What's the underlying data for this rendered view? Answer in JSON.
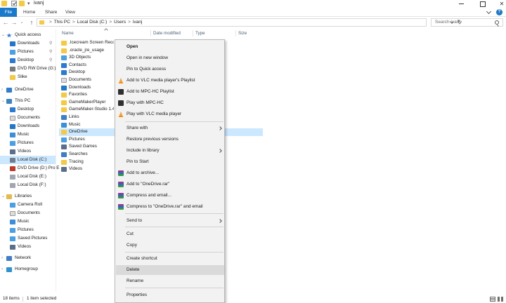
{
  "window": {
    "title": "ivanj"
  },
  "ribbon": {
    "tabs": [
      "File",
      "Home",
      "Share",
      "View"
    ]
  },
  "address": {
    "crumbs": [
      "This PC",
      "Local Disk (C:)",
      "Users",
      "ivanj"
    ],
    "separator": ">"
  },
  "search": {
    "placeholder": "Search ivanj"
  },
  "sidebar": {
    "quick_access": {
      "label": "Quick access",
      "items": [
        {
          "label": "Downloads",
          "pinned": true
        },
        {
          "label": "Pictures",
          "pinned": true
        },
        {
          "label": "Desktop",
          "pinned": true
        },
        {
          "label": "DVD RW Drive (G:)",
          "pinned": false
        },
        {
          "label": "Slike",
          "pinned": false
        }
      ]
    },
    "onedrive": {
      "label": "OneDrive"
    },
    "this_pc": {
      "label": "This PC",
      "items": [
        "Desktop",
        "Documents",
        "Downloads",
        "Music",
        "Pictures",
        "Videos",
        "Local Disk (C:)",
        "DVD Drive (D:) Pro E",
        "Local Disk (E:)",
        "Local Disk (F:)"
      ],
      "selected": "Local Disk (C:)"
    },
    "libraries": {
      "label": "Libraries",
      "items": [
        "Camera Roll",
        "Documents",
        "Music",
        "Pictures",
        "Saved Pictures",
        "Videos"
      ]
    },
    "network": {
      "label": "Network"
    },
    "homegroup": {
      "label": "Homegroup"
    }
  },
  "filelist": {
    "columns": [
      "Name",
      "Date modified",
      "Type",
      "Size"
    ],
    "rows": [
      {
        "name": ".Icecream Screen Recorder",
        "icon": "folder-icon"
      },
      {
        "name": ".oracle_jre_usage",
        "icon": "folder-icon"
      },
      {
        "name": "3D Objects",
        "icon": "cube-icon"
      },
      {
        "name": "Contacts",
        "icon": "contacts-icon"
      },
      {
        "name": "Desktop",
        "icon": "desktop-icon"
      },
      {
        "name": "Documents",
        "icon": "documents-icon"
      },
      {
        "name": "Downloads",
        "icon": "downloads-icon"
      },
      {
        "name": "Favorites",
        "icon": "star-icon"
      },
      {
        "name": "GameMakerPlayer",
        "icon": "folder-icon"
      },
      {
        "name": "GameMaker-Studio 1.4",
        "icon": "folder-icon"
      },
      {
        "name": "Links",
        "icon": "links-icon"
      },
      {
        "name": "Music",
        "icon": "music-icon"
      },
      {
        "name": "OneDrive",
        "icon": "folder-icon"
      },
      {
        "name": "Pictures",
        "icon": "pictures-icon"
      },
      {
        "name": "Saved Games",
        "icon": "saved-games-icon"
      },
      {
        "name": "Searches",
        "icon": "searches-icon"
      },
      {
        "name": "Tracing",
        "icon": "folder-icon"
      },
      {
        "name": "Videos",
        "icon": "videos-icon"
      }
    ],
    "selected": "OneDrive"
  },
  "context_menu": {
    "items": [
      {
        "label": "Open",
        "bold": true
      },
      {
        "label": "Open in new window"
      },
      {
        "label": "Pin to Quick access"
      },
      {
        "label": "Add to VLC media player's Playlist",
        "icon": "vlc-icon"
      },
      {
        "label": "Add to MPC-HC Playlist",
        "icon": "mpc-hc-icon"
      },
      {
        "label": "Play with MPC-HC",
        "icon": "mpc-hc-icon"
      },
      {
        "label": "Play with VLC media player",
        "icon": "vlc-icon"
      },
      {
        "label": "Share with",
        "submenu": true
      },
      {
        "label": "Restore previous versions"
      },
      {
        "label": "Include in library",
        "submenu": true
      },
      {
        "label": "Pin to Start"
      },
      {
        "label": "Add to archive...",
        "icon": "winrar-icon"
      },
      {
        "label": "Add to \"OneDrive.rar\"",
        "icon": "winrar-icon"
      },
      {
        "label": "Compress and email...",
        "icon": "winrar-icon"
      },
      {
        "label": "Compress to \"OneDrive.rar\" and email",
        "icon": "winrar-icon"
      },
      {
        "label": "Send to",
        "submenu": true
      },
      {
        "label": "Cut"
      },
      {
        "label": "Copy"
      },
      {
        "label": "Create shortcut"
      },
      {
        "label": "Delete",
        "highlighted": true
      },
      {
        "label": "Rename"
      },
      {
        "label": "Properties"
      }
    ]
  },
  "status": {
    "item_count": "18 items",
    "selection": "1 item selected"
  },
  "colors": {
    "accent": "#1979ca",
    "selection": "#cce8ff",
    "folder": "#f6c945",
    "menu_bg": "#f2f2f2",
    "menu_hover": "#dadada"
  }
}
